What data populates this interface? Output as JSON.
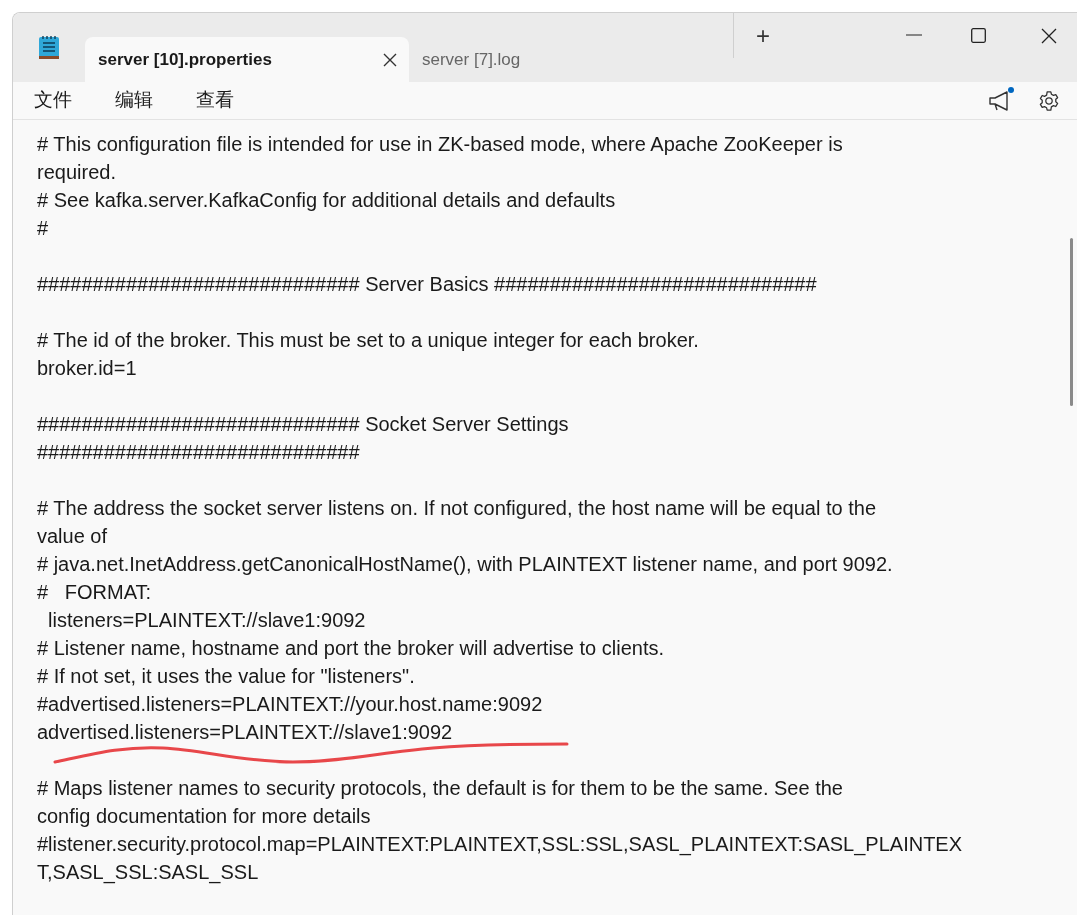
{
  "tabs": [
    {
      "label": "server [10].properties",
      "selected": true,
      "closable": true
    },
    {
      "label": "server [7].log",
      "selected": false,
      "closable": false
    }
  ],
  "new_tab": "+",
  "menu": [
    "文件",
    "编辑",
    "查看"
  ],
  "notification_dot": true,
  "lines": [
    {
      "kind": "text",
      "text": "# This configuration file is intended for use in ZK-based mode, where Apache ZooKeeper is"
    },
    {
      "kind": "text",
      "text": "required."
    },
    {
      "kind": "text",
      "text": "# See kafka.server.KafkaConfig for additional details and defaults"
    },
    {
      "kind": "text",
      "text": "#"
    },
    {
      "kind": "blank"
    },
    {
      "kind": "text",
      "text": "############################# Server Basics #############################"
    },
    {
      "kind": "blank"
    },
    {
      "kind": "text",
      "text": "# The id of the broker. This must be set to a unique integer for each broker."
    },
    {
      "kind": "text",
      "text": "broker.id=1"
    },
    {
      "kind": "blank"
    },
    {
      "kind": "text",
      "text": "############################# Socket Server Settings"
    },
    {
      "kind": "text",
      "text": "#############################"
    },
    {
      "kind": "blank"
    },
    {
      "kind": "text",
      "text": "# The address the socket server listens on. If not configured, the host name will be equal to the"
    },
    {
      "kind": "text",
      "text": "value of"
    },
    {
      "kind": "text",
      "text": "# java.net.InetAddress.getCanonicalHostName(), with PLAINTEXT listener name, and port 9092."
    },
    {
      "kind": "text",
      "text": "#   FORMAT:"
    },
    {
      "kind": "text",
      "text": "  listeners=PLAINTEXT://slave1:9092"
    },
    {
      "kind": "text",
      "text": "# Listener name, hostname and port the broker will advertise to clients."
    },
    {
      "kind": "text",
      "text": "# If not set, it uses the value for \"listeners\"."
    },
    {
      "kind": "text",
      "text": "#advertised.listeners=PLAINTEXT://your.host.name:9092"
    },
    {
      "kind": "text",
      "text": "advertised.listeners=PLAINTEXT://slave1:9092",
      "underlined": true
    },
    {
      "kind": "blank"
    },
    {
      "kind": "text",
      "text": "# Maps listener names to security protocols, the default is for them to be the same. See the"
    },
    {
      "kind": "text",
      "text": "config documentation for more details"
    },
    {
      "kind": "text",
      "text": "#listener.security.protocol.map=PLAINTEXT:PLAINTEXT,SSL:SSL,SASL_PLAINTEXT:SASL_PLAINTEX"
    },
    {
      "kind": "text",
      "text": "T,SASL_SSL:SASL_SSL"
    }
  ]
}
